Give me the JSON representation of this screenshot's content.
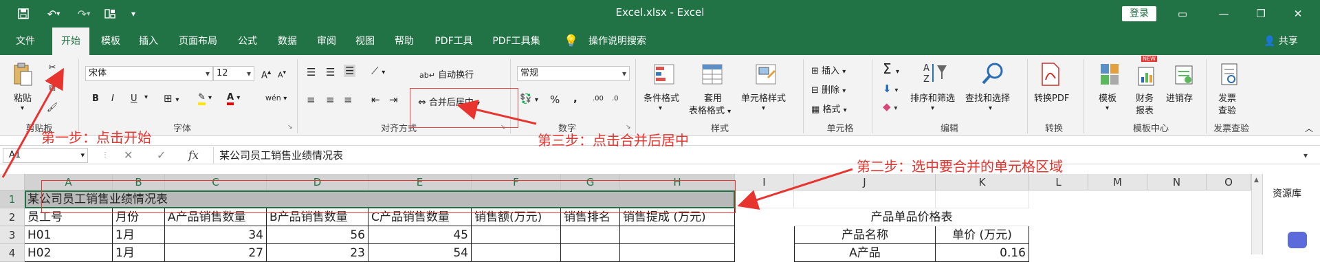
{
  "window": {
    "title": "Excel.xlsx  -  Excel",
    "login_label": "登录",
    "share_label": "共享",
    "quick_access": [
      "save-icon",
      "undo-icon",
      "redo-icon",
      "touch-mode-icon",
      "customize-icon"
    ]
  },
  "menu": {
    "tabs": [
      "文件",
      "开始",
      "模板",
      "插入",
      "页面布局",
      "公式",
      "数据",
      "审阅",
      "视图",
      "帮助",
      "PDF工具",
      "PDF工具集"
    ],
    "active_tab": "开始",
    "tell_me": "操作说明搜索"
  },
  "ribbon": {
    "clipboard": {
      "paste": "粘贴",
      "label": "剪贴板"
    },
    "font": {
      "name": "宋体",
      "size": "12",
      "label": "字体",
      "bold": "B",
      "italic": "I",
      "underline": "U",
      "phonetic": "wén"
    },
    "alignment": {
      "wrap": "自动换行",
      "merge": "合并后居中",
      "label": "对齐方式"
    },
    "number": {
      "format": "常规",
      "label": "数字",
      "percent": "%",
      "comma": ",",
      "inc_decimal": ".00",
      "dec_decimal": ".0"
    },
    "styles": {
      "conditional": "条件格式",
      "table_line1": "套用",
      "table_line2": "表格格式",
      "cell_styles": "单元格样式",
      "label": "样式"
    },
    "cells": {
      "insert": "插入",
      "delete": "删除",
      "format": "格式",
      "label": "单元格"
    },
    "editing": {
      "sort": "排序和筛选",
      "find": "查找和选择",
      "label": "编辑"
    },
    "convert": {
      "to_pdf": "转换PDF",
      "label": "转换"
    },
    "template_center": {
      "template": "模板",
      "finance_line1": "财务",
      "finance_line2": "报表",
      "invoice": "进销存",
      "label": "模板中心",
      "new_badge": "NEW"
    },
    "invoice_check": {
      "line1": "发票",
      "line2": "查验",
      "label": "发票查验"
    }
  },
  "formula_bar": {
    "name_box": "A1",
    "cancel": "✕",
    "enter": "✓",
    "fx": "fx",
    "formula": "某公司员工销售业绩情况表"
  },
  "grid": {
    "columns": [
      "A",
      "B",
      "C",
      "D",
      "E",
      "F",
      "G",
      "H",
      "I",
      "J",
      "K",
      "L",
      "M",
      "N",
      "O"
    ],
    "rows": [
      "1",
      "2",
      "3",
      "4"
    ],
    "a1": "某公司员工销售业绩情况表",
    "header_row": [
      "员工号",
      "月份",
      "A产品销售数量",
      "B产品销售数量",
      "C产品销售数量",
      "销售额(万元)",
      "销售排名",
      "销售提成 (万元)"
    ],
    "row3": [
      "H01",
      "1月",
      "34",
      "56",
      "45"
    ],
    "row4": [
      "H02",
      "1月",
      "27",
      "23",
      "54"
    ],
    "price_table": {
      "title": "产品单品价格表",
      "col1": "产品名称",
      "col2": "单价 (万元)",
      "r1_name": "A产品",
      "r1_price": "0.16"
    }
  },
  "side_pane": {
    "label": "资源库"
  },
  "annotations": {
    "step1": "第一步：点击开始",
    "step2": "第二步：选中要合并的单元格区域",
    "step3": "第三步：点击合并后居中"
  },
  "colors": {
    "excel_green": "#217346",
    "annotation_red": "#e8342f"
  }
}
